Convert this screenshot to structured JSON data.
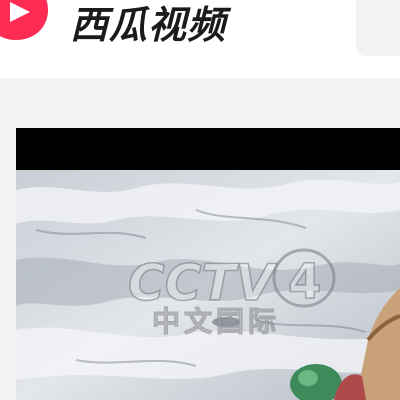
{
  "header": {
    "brand_name": "西瓜视频",
    "logo_icon": "xigua-play-icon",
    "brand_color": "#fe2c55"
  },
  "search": {
    "icon": "search-icon"
  },
  "player": {
    "watermark": {
      "logo_text": "CCTV",
      "channel_number": "4",
      "channel_name": "中文国际"
    }
  }
}
